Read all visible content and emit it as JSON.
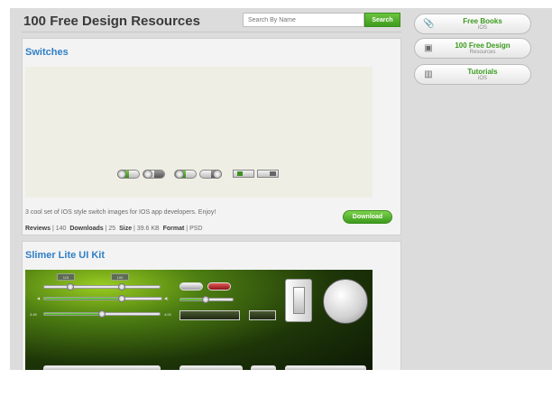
{
  "header": {
    "title": "100 Free Design Resources",
    "search_placeholder": "Search By Name",
    "search_button": "Search"
  },
  "sidebar": {
    "items": [
      {
        "title": "Free Books",
        "subtitle": "iOS",
        "icon": "paperclip-icon"
      },
      {
        "title": "100 Free Design",
        "subtitle": "Resources",
        "icon": "image-icon"
      },
      {
        "title": "Tutorials",
        "subtitle": "iOS",
        "icon": "book-icon"
      }
    ]
  },
  "resources": [
    {
      "title": "Switches",
      "description": "3 cool set of IOS style switch images for IOS app developers. Enjoy!",
      "reviews_label": "Reviews",
      "reviews": "140",
      "downloads_label": "Downloads",
      "downloads": "25",
      "size_label": "Size",
      "size": "39.6 KB",
      "format_label": "Format",
      "format": "PSD",
      "download_button": "Download"
    },
    {
      "title": "Slimer Lite UI Kit"
    }
  ],
  "preview": {
    "switch_on": "ON",
    "switch_off": "OFF",
    "tag_min": "115",
    "tag_max": "100",
    "value_a": "3:45",
    "value_b": "4:00"
  },
  "colors": {
    "accent_green": "#3f9a1e",
    "link_blue": "#2f7fc6"
  }
}
